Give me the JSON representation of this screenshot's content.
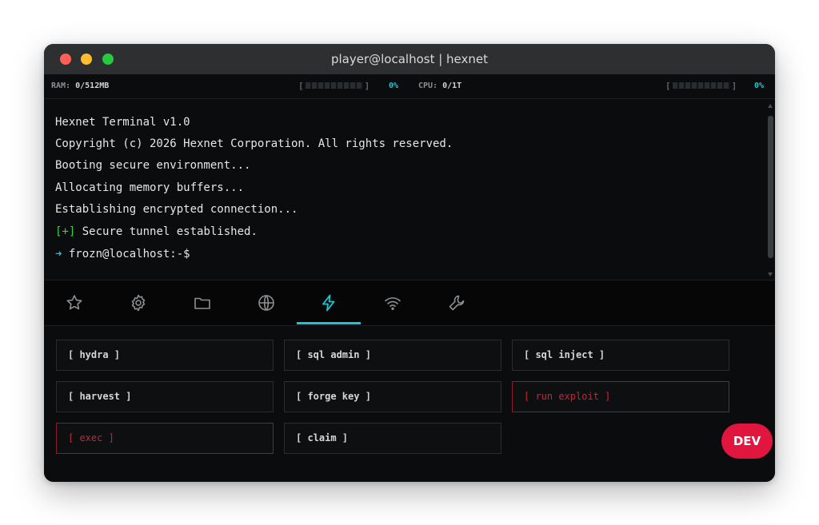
{
  "window": {
    "title": "player@localhost | hexnet"
  },
  "status": {
    "ram_label": "RAM:",
    "ram_value": "0/512MB",
    "ram_bar_open": "[",
    "ram_bar_close": "]",
    "ram_percent": "0%",
    "ram_level": 0,
    "cpu_label": "CPU:",
    "cpu_value": "0/1T",
    "cpu_bar_open": "[",
    "cpu_bar_close": "]",
    "cpu_percent": "0%",
    "cpu_level": 0
  },
  "terminal": {
    "lines": [
      "Hexnet Terminal v1.0",
      "Copyright (c) 2026 Hexnet Corporation. All rights reserved.",
      "Booting secure environment...",
      "Allocating memory buffers...",
      "Establishing encrypted connection..."
    ],
    "ok_tag": "[+]",
    "ok_text": " Secure tunnel established.",
    "prompt_arrow": "➜",
    "prompt": " frozn@localhost:-$"
  },
  "tabs": [
    {
      "icon": "star-icon",
      "active": false
    },
    {
      "icon": "gear-icon",
      "active": false
    },
    {
      "icon": "folder-icon",
      "active": false
    },
    {
      "icon": "globe-icon",
      "active": false
    },
    {
      "icon": "lightning-icon",
      "active": true
    },
    {
      "icon": "wifi-icon",
      "active": false
    },
    {
      "icon": "wrench-icon",
      "active": false
    }
  ],
  "commands": [
    {
      "label": "[ hydra ]",
      "danger": false
    },
    {
      "label": "[ sql admin ]",
      "danger": false
    },
    {
      "label": "[ sql inject ]",
      "danger": false
    },
    {
      "label": "[ harvest ]",
      "danger": false
    },
    {
      "label": "[ forge key ]",
      "danger": false
    },
    {
      "label": "[ run exploit ]",
      "danger": true
    },
    {
      "label": "[ exec ]",
      "danger": true
    },
    {
      "label": "[ claim ]",
      "danger": false
    }
  ],
  "badge": {
    "label": "DEV"
  },
  "colors": {
    "accent": "#19c7d9",
    "danger": "#e0163f",
    "success": "#37d33f"
  }
}
